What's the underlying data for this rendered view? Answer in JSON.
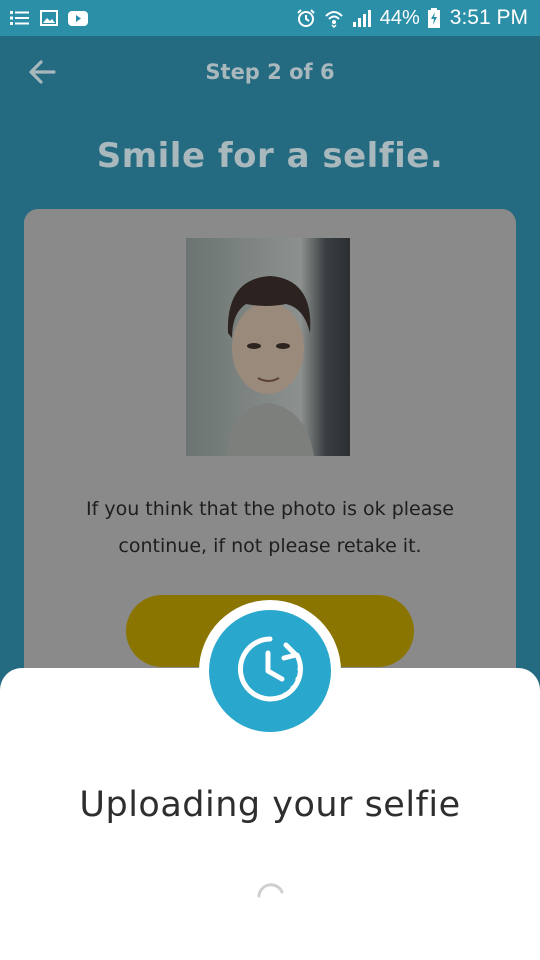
{
  "status_bar": {
    "battery": "44%",
    "time": "3:51 PM",
    "icons": [
      "list-icon",
      "image-icon",
      "youtube-icon",
      "alarm-icon",
      "wifi-icon",
      "signal-icon",
      "battery-charging-icon"
    ]
  },
  "header": {
    "back_icon": "arrow-left-icon",
    "step": "Step 2 of 6"
  },
  "main": {
    "title": "Smile for a selfie.",
    "message_line1": "If you think that the photo is ok please",
    "message_line2": "continue, if not please retake it."
  },
  "sheet": {
    "title": "Uploading your selfie",
    "badge_icon": "clock-refresh-icon",
    "loading_icon": "spinner-icon"
  },
  "colors": {
    "status_bar": "#2b8fa8",
    "accent": "#2aa7cc",
    "button_dimmed": "#8a7500"
  }
}
